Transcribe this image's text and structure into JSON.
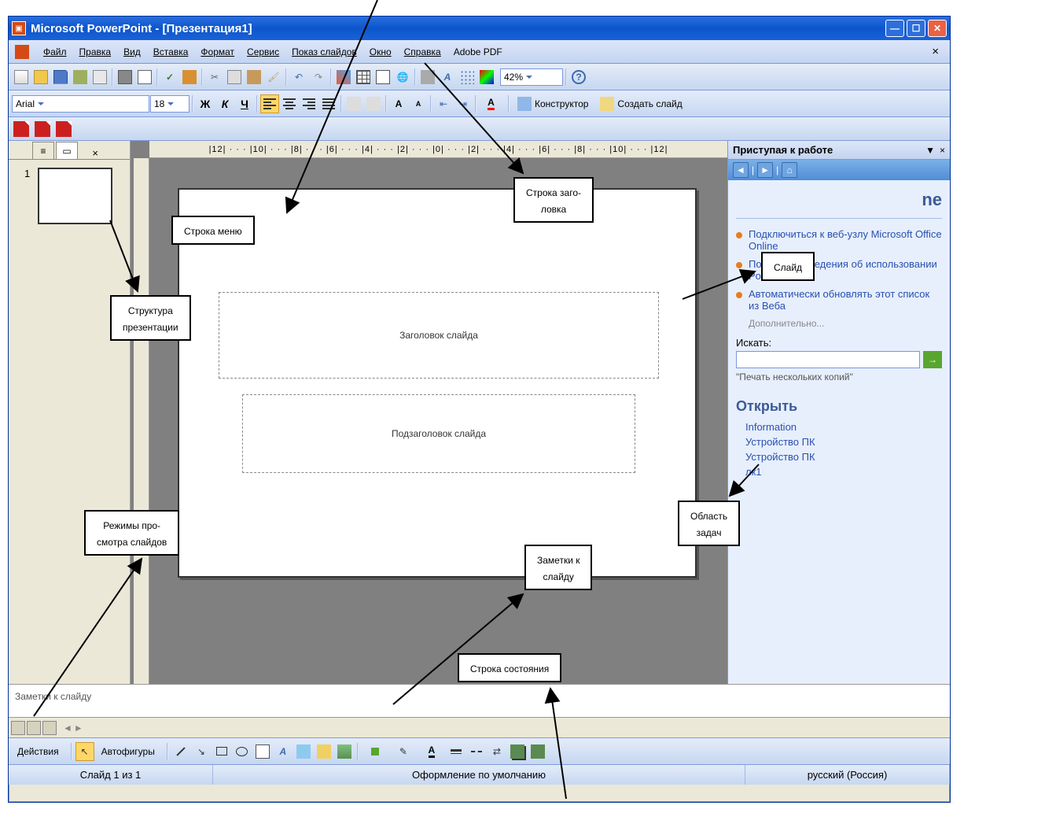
{
  "title": "Microsoft PowerPoint - [Презентация1]",
  "menu": {
    "file": "Файл",
    "edit": "Правка",
    "view": "Вид",
    "insert": "Вставка",
    "format": "Формат",
    "tools": "Сервис",
    "slideshow": "Показ слайдов",
    "window": "Окно",
    "help": "Справка",
    "adobe": "Adobe PDF"
  },
  "toolbar1": {
    "zoom": "42%"
  },
  "toolbar2": {
    "font": "Arial",
    "size": "18",
    "bold": "Ж",
    "italic": "К",
    "underline": "Ч",
    "design": "Конструктор",
    "newslide": "Создать слайд"
  },
  "ruler_text": "|12| · · · |10| · · · |8| · · · |6| · · · |4| · · · |2| · · · |0| · · · |2| · · · |4| · · · |6| · · · |8| · · · |10| · · · |12|",
  "thumb": {
    "num": "1"
  },
  "slide": {
    "title_ph": "Заголовок слайда",
    "subtitle_ph": "Подзаголовок слайда"
  },
  "notes_prompt": "Заметки к слайду",
  "taskpane": {
    "title": "Приступая к работе",
    "heading_suffix": "ne",
    "links": [
      "Подключиться к веб-узлу Microsoft Office Online",
      "Последние сведения об использовании PowerPoint",
      "Автоматически обновлять этот список из Веба"
    ],
    "more": "Дополнительно...",
    "search_lbl": "Искать:",
    "example": "\"Печать нескольких копий\"",
    "open_h": "Открыть",
    "recent": [
      "Information",
      "Устройство ПК",
      "Устройство ПК",
      "лк1"
    ]
  },
  "drawing": {
    "actions": "Действия",
    "autoshapes": "Автофигуры"
  },
  "status": {
    "slide": "Слайд 1 из 1",
    "design": "Оформление по умолчанию",
    "lang": "русский (Россия)"
  },
  "callouts": {
    "menu": "Строка меню",
    "title": "Строка заго-\nловка",
    "struct": "Структура\nпрезентации",
    "slide": "Слайд",
    "views": "Режимы про-\nсмотра слайдов",
    "notes": "Заметки к\nслайду",
    "task": "Область\nзадач",
    "status": "Строка состояния"
  }
}
